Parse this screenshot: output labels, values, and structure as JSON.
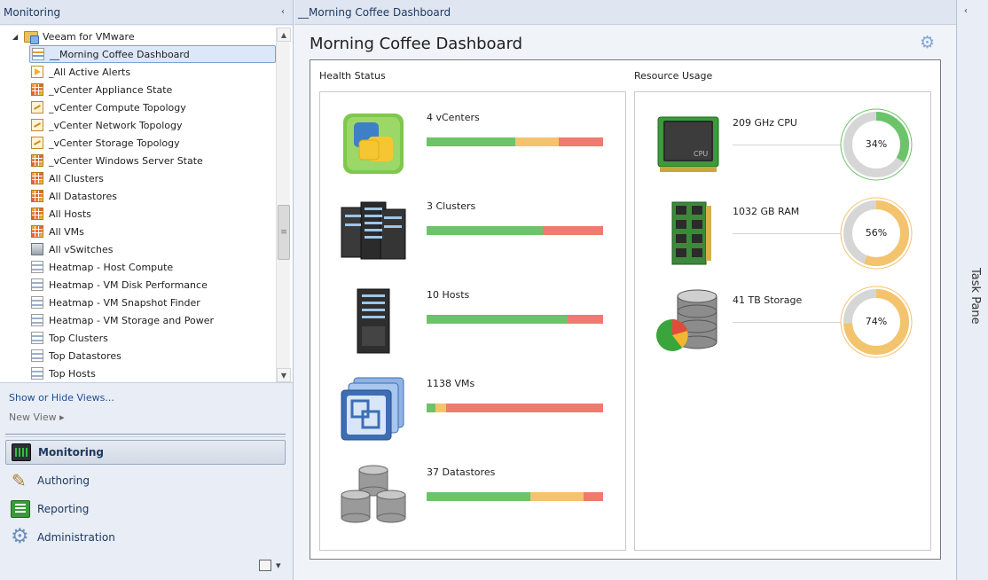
{
  "nav": {
    "title": "Monitoring",
    "collapse_glyph": "‹",
    "root": {
      "label": "Veeam for VMware",
      "expander_glyph": "◢"
    },
    "items": [
      {
        "label": "__Morning Coffee Dashboard",
        "icon": "dashboard-view-icon",
        "selected": true
      },
      {
        "label": "_All Active Alerts",
        "icon": "alert-view-icon"
      },
      {
        "label": "_vCenter Appliance State",
        "icon": "state-view-icon"
      },
      {
        "label": "_vCenter Compute Topology",
        "icon": "topology-view-icon"
      },
      {
        "label": "_vCenter Network Topology",
        "icon": "topology-view-icon"
      },
      {
        "label": "_vCenter Storage Topology",
        "icon": "topology-view-icon"
      },
      {
        "label": "_vCenter Windows Server State",
        "icon": "state-view-icon"
      },
      {
        "label": "All Clusters",
        "icon": "state-view-icon"
      },
      {
        "label": "All Datastores",
        "icon": "state-view-icon"
      },
      {
        "label": "All Hosts",
        "icon": "state-view-icon"
      },
      {
        "label": "All VMs",
        "icon": "state-view-icon"
      },
      {
        "label": "All vSwitches",
        "icon": "switch-view-icon"
      },
      {
        "label": "Heatmap - Host Compute",
        "icon": "dashboard-view-icon"
      },
      {
        "label": "Heatmap - VM Disk Performance",
        "icon": "dashboard-view-icon"
      },
      {
        "label": "Heatmap - VM Snapshot Finder",
        "icon": "dashboard-view-icon"
      },
      {
        "label": "Heatmap - VM Storage and Power",
        "icon": "dashboard-view-icon"
      },
      {
        "label": "Top Clusters",
        "icon": "dashboard-view-icon"
      },
      {
        "label": "Top Datastores",
        "icon": "dashboard-view-icon"
      },
      {
        "label": "Top Hosts",
        "icon": "dashboard-view-icon"
      }
    ],
    "scrollbar": {
      "up_glyph": "▲",
      "down_glyph": "▼",
      "thumb_glyph": "≡"
    },
    "show_hide": "Show or Hide Views...",
    "new_view": "New View ▸",
    "wunderbar": [
      {
        "label": "Monitoring",
        "icon": "monitoring-icon",
        "active": true
      },
      {
        "label": "Authoring",
        "icon": "authoring-icon"
      },
      {
        "label": "Reporting",
        "icon": "reporting-icon"
      },
      {
        "label": "Administration",
        "icon": "administration-icon"
      }
    ],
    "config_glyph": "▾"
  },
  "main": {
    "breadcrumb": "__Morning Coffee Dashboard",
    "title": "Morning Coffee Dashboard",
    "settings_glyph": "⚙",
    "health": {
      "label": "Health Status",
      "rows": [
        {
          "label": "4 vCenters",
          "icon": "vcenter-icon",
          "bar": [
            0.5,
            0.25,
            0.25
          ]
        },
        {
          "label": "3 Clusters",
          "icon": "cluster-servers-icon",
          "bar": [
            0.66,
            0,
            0.34
          ]
        },
        {
          "label": "10 Hosts",
          "icon": "host-server-icon",
          "bar": [
            0.8,
            0,
            0.2
          ]
        },
        {
          "label": "1138 VMs",
          "icon": "virtual-machines-icon",
          "bar": [
            0.05,
            0.06,
            0.89
          ]
        },
        {
          "label": "37 Datastores",
          "icon": "datastores-icon",
          "bar": [
            0.59,
            0.3,
            0.11
          ]
        }
      ]
    },
    "resources": {
      "label": "Resource Usage",
      "rows": [
        {
          "label": "209 GHz CPU",
          "icon": "cpu-chip-icon",
          "percent": 34,
          "percent_label": "34%",
          "color": "#6cc36a"
        },
        {
          "label": "1032 GB RAM",
          "icon": "ram-module-icon",
          "percent": 56,
          "percent_label": "56%",
          "color": "#f4c36d"
        },
        {
          "label": "41 TB Storage",
          "icon": "storage-database-icon",
          "percent": 74,
          "percent_label": "74%",
          "color": "#f4c36d"
        }
      ]
    }
  },
  "task_pane": {
    "label": "Task Pane",
    "collapse_glyph": "‹"
  },
  "colors": {
    "green": "#6cc36a",
    "yellow": "#f4c36d",
    "red": "#ef7a6e",
    "track": "#d6d6d6"
  }
}
